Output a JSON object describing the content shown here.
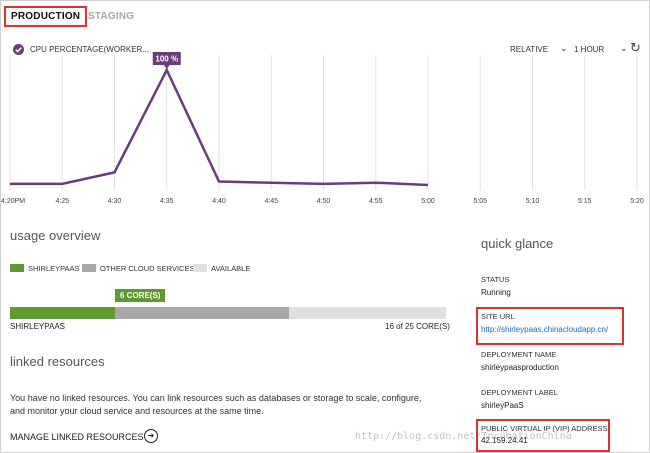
{
  "tabs": [
    {
      "label": "PRODUCTION",
      "active": true
    },
    {
      "label": "STAGING",
      "active": false
    }
  ],
  "chart_header": {
    "metric_label": "CPU PERCENTAGE(WORKER...",
    "mode_label": "RELATIVE",
    "range_label": "1 HOUR",
    "refresh_icon": "refresh-icon",
    "check_icon": "check-circle-icon"
  },
  "chart_data": {
    "type": "line",
    "x": [
      "4:20PM",
      "4:25",
      "4:30",
      "4:35",
      "4:40",
      "4:45",
      "4:50",
      "4:55",
      "5:00",
      "5:05",
      "5:10",
      "5:15",
      "5:20"
    ],
    "series": [
      {
        "values": [
          1,
          1,
          11,
          100,
          3,
          2,
          1,
          2,
          0
        ],
        "color": "#6b3b7a"
      }
    ],
    "annotation": {
      "label": "100 %",
      "at": "4:35"
    },
    "ylim": [
      0,
      100
    ],
    "grid": "vertical"
  },
  "usage": {
    "title": "usage overview",
    "legend": [
      {
        "label": "SHIRLEYPAAS",
        "color": "#5e9a2f"
      },
      {
        "label": "OTHER CLOUD SERVICES",
        "color": "#a8a8a8"
      },
      {
        "label": "AVAILABLE",
        "color": "#e0e0e0"
      }
    ],
    "bar": {
      "callout": "6 CORE(S)",
      "name": "SHIRLEYPAAS",
      "used": 6,
      "other": 10,
      "total": 25,
      "count_label": "16 of 25 CORE(S)"
    }
  },
  "linked": {
    "title": "linked resources",
    "description": "You have no linked resources. You can link resources such as databases or storage to scale, configure, and monitor your cloud service and resources at the same time.",
    "manage_label": "MANAGE LINKED RESOURCES"
  },
  "quick_glance": {
    "title": "quick glance",
    "status_label": "STATUS",
    "status_value": "Running",
    "site_url_label": "SITE URL",
    "site_url_value": "http://shirleypaas.chinacloudapp.cn/",
    "deployment_name_label": "DEPLOYMENT NAME",
    "deployment_name_value": "shirleypaasproduction",
    "deployment_label_label": "DEPLOYMENT LABEL",
    "deployment_label_value": "shirleyPaaS",
    "vip_label": "PUBLIC VIRTUAL IP (VIP) ADDRESS",
    "vip_value": "42.159.24.41"
  },
  "watermark": "http://blog.csdn.net/IncubationChina"
}
